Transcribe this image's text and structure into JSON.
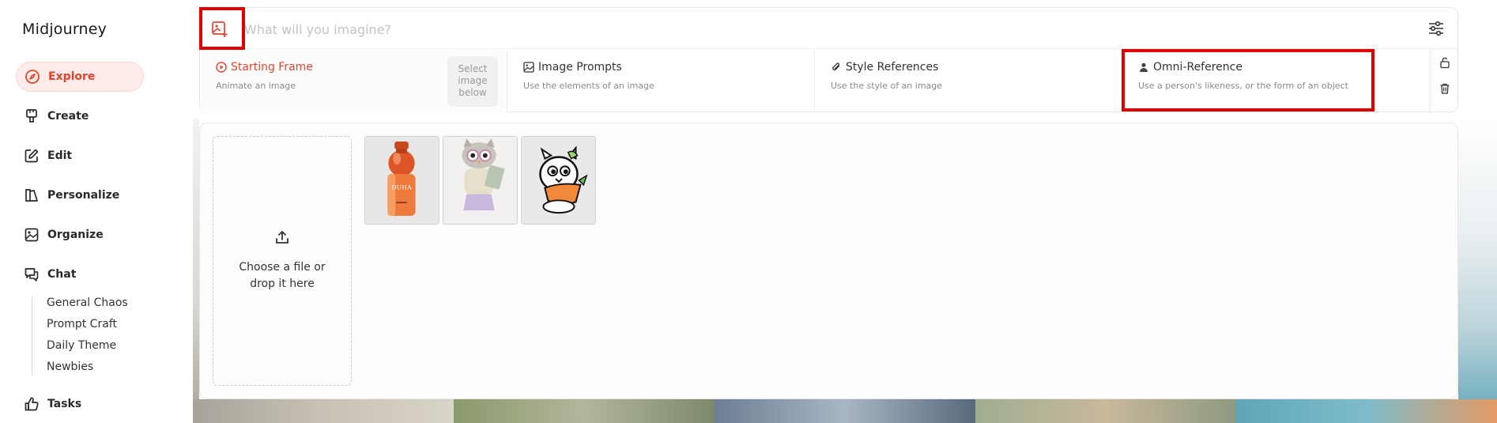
{
  "sidebar": {
    "logo": "Midjourney",
    "items": [
      {
        "label": "Explore",
        "icon": "compass-icon"
      },
      {
        "label": "Create",
        "icon": "paintbrush-icon"
      },
      {
        "label": "Edit",
        "icon": "edit-icon"
      },
      {
        "label": "Personalize",
        "icon": "personalize-icon"
      },
      {
        "label": "Organize",
        "icon": "image-icon"
      },
      {
        "label": "Chat",
        "icon": "chat-icon"
      }
    ],
    "chat_rooms": [
      "General Chaos",
      "Prompt Craft",
      "Daily Theme",
      "Newbies"
    ],
    "tasks": {
      "label": "Tasks",
      "icon": "thumbs-up-icon"
    }
  },
  "prompt": {
    "placeholder": "What will you imagine?"
  },
  "references": [
    {
      "title": "Starting Frame",
      "desc": "Animate an image",
      "icon": "play-circle-icon",
      "select_below": "Select image below"
    },
    {
      "title": "Image Prompts",
      "desc": "Use the elements of an image",
      "icon": "image-icon"
    },
    {
      "title": "Style References",
      "desc": "Use the style of an image",
      "icon": "paperclip-icon"
    },
    {
      "title": "Omni-Reference",
      "desc": "Use a person's likeness, or the form of an object",
      "icon": "person-icon"
    }
  ],
  "upload": {
    "text": "Choose a file or drop it here"
  },
  "thumbnails": [
    {
      "name": "perfume-bottle",
      "label": "DUHA"
    },
    {
      "name": "owl-character"
    },
    {
      "name": "cartoon-creature-carrot"
    }
  ],
  "colors": {
    "accent": "#e0452f",
    "highlight_box": "#e00000",
    "active_bg": "#fdecea"
  }
}
